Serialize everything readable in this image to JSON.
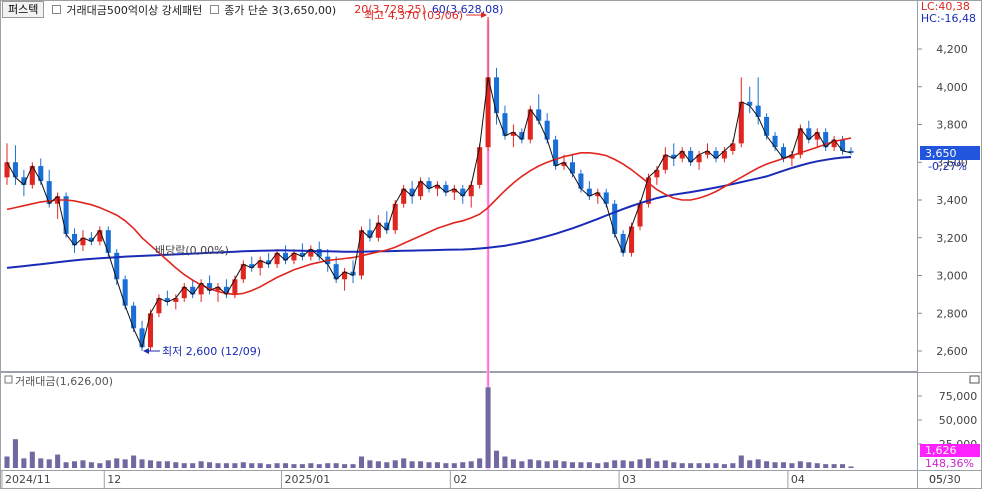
{
  "header": {
    "market_tab": "퍼스텍",
    "screen_name": "거래대금500억이상 강세패턴",
    "close_simple": "종가 단순 3(3,650,00)",
    "ma20": "20(3,728,25)",
    "ma60": "60(3,628,08)",
    "lc": "LC:40,38",
    "hc": "HC:-16,48"
  },
  "annotations": {
    "high": "최고 4,370 (03/06)",
    "low": "최저 2,600 (12/09)",
    "dividend": "배당락(0,00%)",
    "current_price": "3,650",
    "current_change": "-0,27%",
    "current_volume": "1,626",
    "volume_change": "148,36%"
  },
  "volume_panel": {
    "title": "거래대금(1,626,00)"
  },
  "price_axis": {
    "labels": [
      "4,200",
      "4,000",
      "3,800",
      "3,600",
      "3,400",
      "3,200",
      "3,000",
      "2,800",
      "2,600"
    ]
  },
  "volume_axis": {
    "labels": [
      "75,000",
      "50,000",
      "25,000"
    ]
  },
  "date_axis": {
    "labels": [
      "2024/11",
      "12",
      "2025/01",
      "02",
      "03",
      "04",
      "05",
      "05/30"
    ]
  },
  "colors": {
    "up": "#e0251f",
    "down": "#1a6fd6",
    "ma20": "#e0251f",
    "ma60": "#1a2bb8",
    "close_line": "#111111",
    "volume": "#7068a0",
    "current_price_bg": "#2255dd",
    "current_volume_bg": "#ff22ff"
  },
  "chart_data": [
    {
      "type": "candlestick",
      "title": "퍼스텍",
      "ylim": [
        2520,
        4420
      ],
      "grid": false,
      "candles": [
        [
          3520,
          3700,
          3480,
          3600
        ],
        [
          3600,
          3690,
          3480,
          3520
        ],
        [
          3520,
          3560,
          3420,
          3480
        ],
        [
          3480,
          3600,
          3460,
          3580
        ],
        [
          3580,
          3620,
          3480,
          3500
        ],
        [
          3500,
          3560,
          3360,
          3380
        ],
        [
          3380,
          3440,
          3300,
          3420
        ],
        [
          3420,
          3440,
          3200,
          3220
        ],
        [
          3220,
          3250,
          3120,
          3160
        ],
        [
          3160,
          3240,
          3130,
          3200
        ],
        [
          3200,
          3230,
          3160,
          3180
        ],
        [
          3180,
          3260,
          3160,
          3240
        ],
        [
          3240,
          3260,
          3100,
          3120
        ],
        [
          3120,
          3140,
          2950,
          2980
        ],
        [
          2980,
          3000,
          2820,
          2840
        ],
        [
          2840,
          2860,
          2700,
          2720
        ],
        [
          2720,
          2760,
          2600,
          2620
        ],
        [
          2620,
          2820,
          2600,
          2800
        ],
        [
          2800,
          2900,
          2780,
          2880
        ],
        [
          2880,
          2920,
          2840,
          2860
        ],
        [
          2860,
          2900,
          2820,
          2880
        ],
        [
          2880,
          2960,
          2860,
          2940
        ],
        [
          2940,
          2980,
          2880,
          2900
        ],
        [
          2900,
          2980,
          2860,
          2960
        ],
        [
          2960,
          3000,
          2900,
          2920
        ],
        [
          2920,
          2960,
          2860,
          2940
        ],
        [
          2940,
          2980,
          2880,
          2900
        ],
        [
          2900,
          3000,
          2880,
          2980
        ],
        [
          2980,
          3080,
          2960,
          3060
        ],
        [
          3060,
          3100,
          3020,
          3040
        ],
        [
          3040,
          3100,
          3000,
          3080
        ],
        [
          3080,
          3120,
          3040,
          3060
        ],
        [
          3060,
          3140,
          3040,
          3120
        ],
        [
          3120,
          3160,
          3060,
          3080
        ],
        [
          3080,
          3140,
          3060,
          3120
        ],
        [
          3120,
          3170,
          3080,
          3100
        ],
        [
          3100,
          3160,
          3080,
          3140
        ],
        [
          3140,
          3180,
          3080,
          3100
        ],
        [
          3100,
          3140,
          3020,
          3060
        ],
        [
          3060,
          3100,
          2960,
          2980
        ],
        [
          2980,
          3040,
          2920,
          3020
        ],
        [
          3020,
          3080,
          2960,
          3000
        ],
        [
          3000,
          3260,
          2980,
          3240
        ],
        [
          3240,
          3300,
          3180,
          3200
        ],
        [
          3200,
          3320,
          3180,
          3280
        ],
        [
          3280,
          3340,
          3220,
          3240
        ],
        [
          3240,
          3400,
          3220,
          3380
        ],
        [
          3380,
          3480,
          3360,
          3460
        ],
        [
          3460,
          3500,
          3380,
          3420
        ],
        [
          3420,
          3520,
          3400,
          3500
        ],
        [
          3500,
          3520,
          3440,
          3460
        ],
        [
          3460,
          3500,
          3420,
          3480
        ],
        [
          3480,
          3500,
          3420,
          3440
        ],
        [
          3440,
          3480,
          3400,
          3460
        ],
        [
          3460,
          3480,
          3380,
          3420
        ],
        [
          3420,
          3500,
          3360,
          3480
        ],
        [
          3480,
          3700,
          3460,
          3680
        ],
        [
          3680,
          4370,
          3660,
          4050
        ],
        [
          4050,
          4100,
          3800,
          3860
        ],
        [
          3860,
          3900,
          3720,
          3740
        ],
        [
          3740,
          3800,
          3680,
          3760
        ],
        [
          3760,
          3780,
          3700,
          3720
        ],
        [
          3720,
          3900,
          3700,
          3880
        ],
        [
          3880,
          3960,
          3800,
          3820
        ],
        [
          3820,
          3860,
          3700,
          3720
        ],
        [
          3720,
          3740,
          3560,
          3580
        ],
        [
          3580,
          3640,
          3560,
          3600
        ],
        [
          3600,
          3640,
          3520,
          3540
        ],
        [
          3540,
          3560,
          3440,
          3460
        ],
        [
          3460,
          3500,
          3400,
          3420
        ],
        [
          3420,
          3460,
          3380,
          3440
        ],
        [
          3440,
          3460,
          3360,
          3380
        ],
        [
          3380,
          3400,
          3200,
          3220
        ],
        [
          3220,
          3240,
          3100,
          3120
        ],
        [
          3120,
          3280,
          3100,
          3260
        ],
        [
          3260,
          3400,
          3240,
          3380
        ],
        [
          3380,
          3540,
          3360,
          3520
        ],
        [
          3520,
          3580,
          3480,
          3560
        ],
        [
          3560,
          3680,
          3540,
          3640
        ],
        [
          3640,
          3700,
          3580,
          3620
        ],
        [
          3620,
          3680,
          3600,
          3660
        ],
        [
          3660,
          3680,
          3580,
          3600
        ],
        [
          3600,
          3660,
          3560,
          3640
        ],
        [
          3640,
          3700,
          3620,
          3660
        ],
        [
          3660,
          3680,
          3600,
          3620
        ],
        [
          3620,
          3680,
          3600,
          3660
        ],
        [
          3660,
          3720,
          3640,
          3700
        ],
        [
          3700,
          4050,
          3680,
          3920
        ],
        [
          3920,
          4000,
          3860,
          3900
        ],
        [
          3900,
          4050,
          3800,
          3840
        ],
        [
          3840,
          3860,
          3720,
          3740
        ],
        [
          3740,
          3760,
          3660,
          3680
        ],
        [
          3680,
          3700,
          3600,
          3620
        ],
        [
          3620,
          3660,
          3580,
          3640
        ],
        [
          3640,
          3800,
          3620,
          3780
        ],
        [
          3780,
          3820,
          3700,
          3720
        ],
        [
          3720,
          3780,
          3680,
          3760
        ],
        [
          3760,
          3780,
          3660,
          3680
        ],
        [
          3680,
          3740,
          3660,
          3720
        ],
        [
          3720,
          3740,
          3640,
          3660
        ],
        [
          3660,
          3680,
          3640,
          3650
        ]
      ],
      "ma20": [
        3350,
        3360,
        3370,
        3380,
        3390,
        3395,
        3400,
        3400,
        3395,
        3385,
        3375,
        3360,
        3340,
        3320,
        3290,
        3250,
        3200,
        3160,
        3120,
        3080,
        3040,
        3005,
        2975,
        2950,
        2930,
        2915,
        2905,
        2900,
        2905,
        2920,
        2940,
        2965,
        2990,
        3010,
        3030,
        3045,
        3060,
        3070,
        3080,
        3085,
        3090,
        3095,
        3105,
        3115,
        3125,
        3135,
        3150,
        3170,
        3190,
        3210,
        3230,
        3250,
        3265,
        3280,
        3290,
        3305,
        3325,
        3360,
        3405,
        3450,
        3490,
        3525,
        3555,
        3580,
        3600,
        3615,
        3630,
        3640,
        3650,
        3650,
        3645,
        3635,
        3615,
        3590,
        3560,
        3525,
        3490,
        3455,
        3430,
        3410,
        3400,
        3400,
        3410,
        3425,
        3445,
        3470,
        3495,
        3520,
        3545,
        3570,
        3590,
        3605,
        3620,
        3635,
        3650,
        3665,
        3680,
        3695,
        3710,
        3720,
        3728
      ],
      "ma60": [
        3040,
        3045,
        3050,
        3055,
        3060,
        3065,
        3070,
        3075,
        3080,
        3085,
        3088,
        3091,
        3094,
        3097,
        3100,
        3102,
        3104,
        3106,
        3108,
        3110,
        3112,
        3114,
        3116,
        3118,
        3120,
        3122,
        3124,
        3126,
        3128,
        3130,
        3131,
        3132,
        3133,
        3133,
        3132,
        3131,
        3130,
        3129,
        3128,
        3127,
        3126,
        3126,
        3126,
        3127,
        3128,
        3129,
        3130,
        3131,
        3132,
        3133,
        3134,
        3135,
        3136,
        3137,
        3138,
        3140,
        3143,
        3147,
        3152,
        3158,
        3166,
        3175,
        3185,
        3196,
        3208,
        3221,
        3235,
        3250,
        3266,
        3283,
        3300,
        3318,
        3335,
        3352,
        3368,
        3383,
        3397,
        3410,
        3420,
        3428,
        3435,
        3442,
        3450,
        3458,
        3466,
        3475,
        3485,
        3495,
        3505,
        3515,
        3525,
        3540,
        3555,
        3570,
        3583,
        3595,
        3605,
        3613,
        3620,
        3625,
        3628
      ],
      "volume": [
        12000,
        30000,
        10000,
        17000,
        10000,
        9000,
        14000,
        6000,
        7000,
        8000,
        6000,
        5000,
        8000,
        10000,
        9000,
        13000,
        9000,
        8000,
        7000,
        7000,
        6000,
        5000,
        5000,
        7000,
        6000,
        5000,
        5000,
        5000,
        6000,
        5000,
        5000,
        4000,
        5000,
        5000,
        4000,
        4000,
        5000,
        4000,
        5000,
        5000,
        4000,
        4000,
        12000,
        8000,
        7000,
        6000,
        8000,
        10000,
        7000,
        7000,
        6000,
        6000,
        5000,
        5000,
        6000,
        7000,
        10000,
        84000,
        18000,
        12000,
        9000,
        7000,
        9000,
        8000,
        7000,
        8000,
        7000,
        6000,
        6000,
        6000,
        5000,
        6000,
        8000,
        8000,
        7000,
        9000,
        10000,
        7000,
        8000,
        6000,
        5000,
        5000,
        5000,
        5000,
        5000,
        4000,
        5000,
        13000,
        8000,
        9000,
        7000,
        6000,
        6000,
        5000,
        7000,
        6000,
        5000,
        4000,
        4000,
        4000,
        1626
      ]
    }
  ]
}
